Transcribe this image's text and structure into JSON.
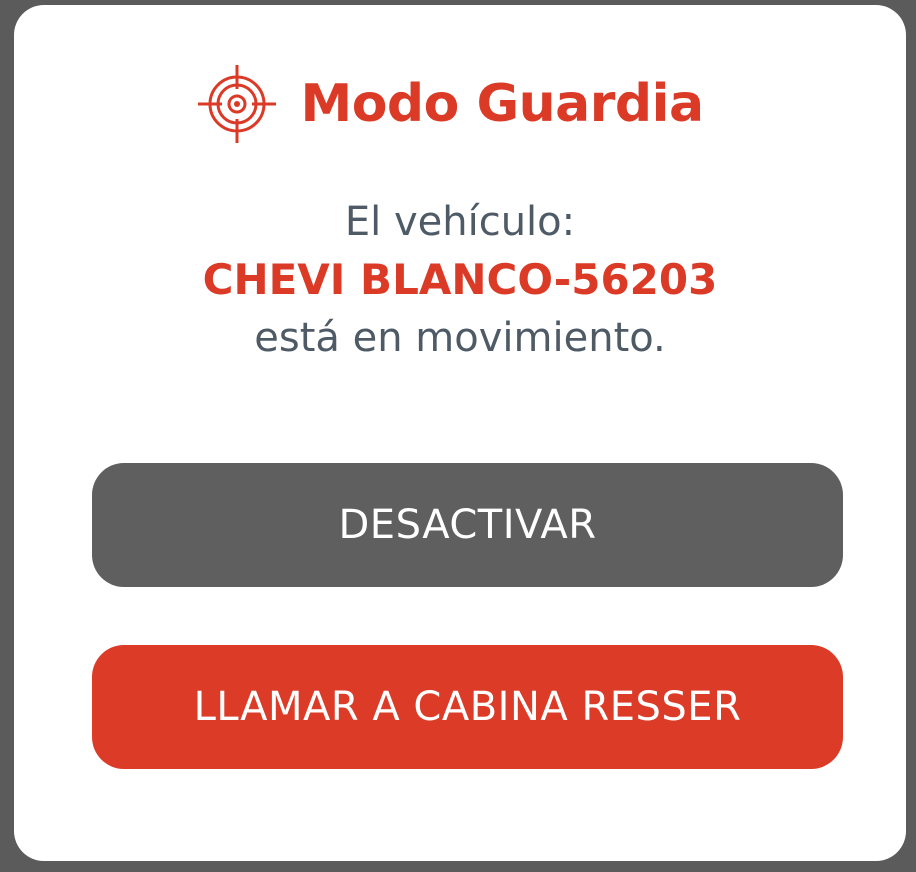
{
  "dialog": {
    "title": "Modo Guardia",
    "title_icon": "crosshair-target-icon",
    "message_line1": "El vehículo:",
    "vehicle_name": "CHEVI BLANCO-56203",
    "message_line3": "está en movimiento.",
    "deactivate_label": "DESACTIVAR",
    "call_label": "LLAMAR A CABINA RESSER"
  },
  "colors": {
    "accent": "#db3a27",
    "text": "#4e5b67",
    "deactivate_button": "#5f5f5f",
    "backdrop": "#5b5b5b"
  }
}
